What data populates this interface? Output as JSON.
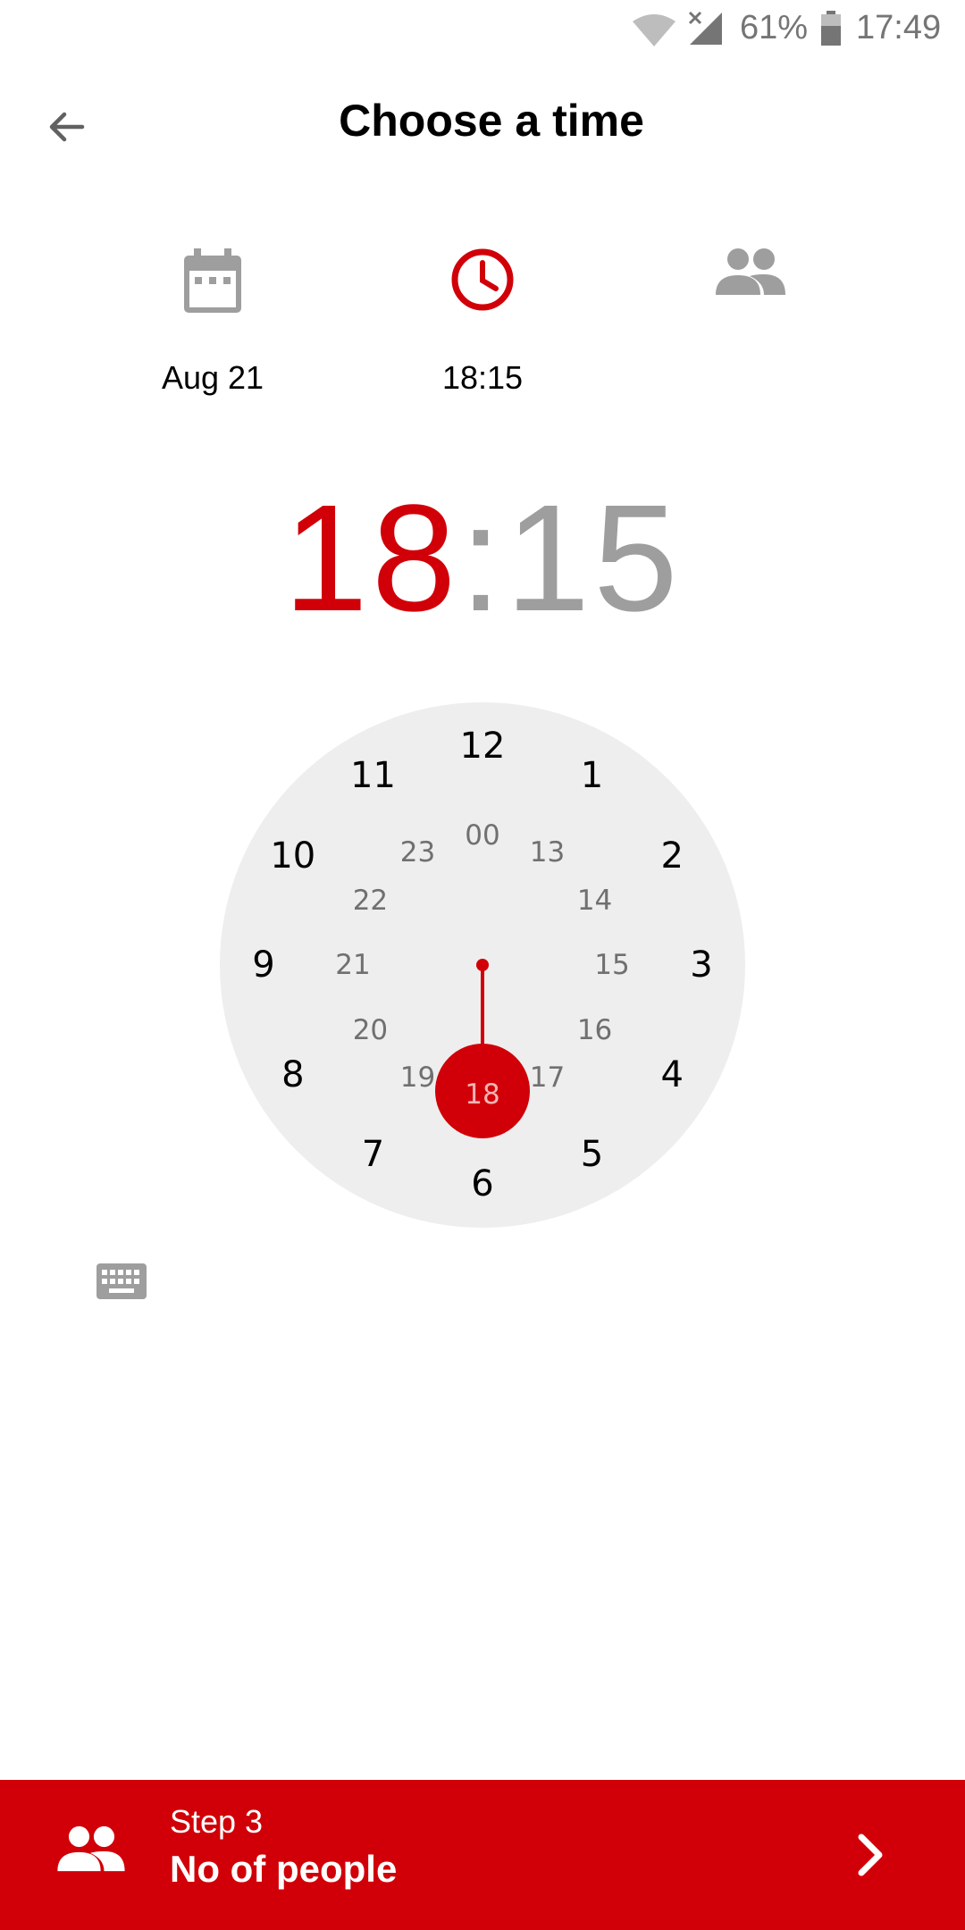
{
  "status_bar": {
    "battery_percent": "61%",
    "time": "17:49",
    "icons": [
      "wifi-icon",
      "cell-signal-no-data-icon",
      "battery-icon"
    ]
  },
  "header": {
    "title": "Choose a time",
    "back_icon": "arrow-back-icon"
  },
  "steps": [
    {
      "icon": "calendar-icon",
      "label": "Aug 21",
      "active": false
    },
    {
      "icon": "clock-icon",
      "label": "18:15",
      "active": true
    },
    {
      "icon": "people-icon",
      "label": "",
      "active": false
    }
  ],
  "time": {
    "hours": "18",
    "separator": ":",
    "minutes": "15"
  },
  "dial": {
    "outer": [
      "12",
      "1",
      "2",
      "3",
      "4",
      "5",
      "6",
      "7",
      "8",
      "9",
      "10",
      "11"
    ],
    "inner": [
      "00",
      "13",
      "14",
      "15",
      "16",
      "17",
      "18",
      "19",
      "20",
      "21",
      "22",
      "23"
    ],
    "selected": "18"
  },
  "keyboard_toggle_icon": "keyboard-icon",
  "bottom_bar": {
    "step_number": "Step 3",
    "step_name": "No of people",
    "icon": "people-icon",
    "next_icon": "chevron-right-icon"
  },
  "colors": {
    "accent": "#d10008",
    "dial_background": "#eeeeee",
    "secondary_text": "#9e9e9e",
    "icon_grey": "#9e9e9e"
  }
}
